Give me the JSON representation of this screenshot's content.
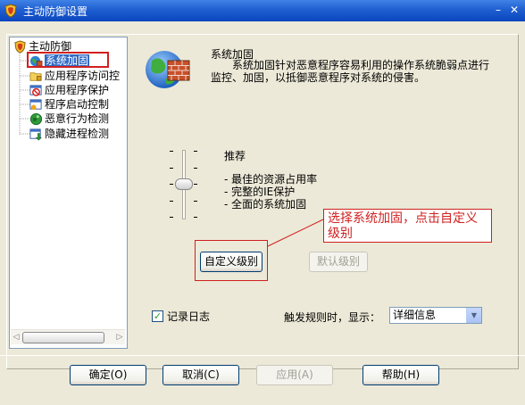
{
  "window": {
    "title": "主动防御设置",
    "minimize_label": "–",
    "close_label": "✕"
  },
  "tree": {
    "root_label": "主动防御",
    "items": [
      {
        "label": "系统加固",
        "icon": "globe-shield-icon",
        "selected": true
      },
      {
        "label": "应用程序访问控",
        "icon": "folder-lock-icon"
      },
      {
        "label": "应用程序保护",
        "icon": "forbidden-window-icon"
      },
      {
        "label": "程序启动控制",
        "icon": "window-start-icon"
      },
      {
        "label": "恶意行为检测",
        "icon": "green-globe-icon"
      },
      {
        "label": "隐藏进程检测",
        "icon": "window-down-arrow-icon"
      }
    ]
  },
  "section": {
    "title": "系统加固",
    "desc_line1": "系统加固针对恶意程序容易利用的操作系统脆弱点进行",
    "desc_line2": "监控、加固，以抵御恶意程序对系统的侵害。"
  },
  "level": {
    "title": "推荐",
    "bullets": [
      "- 最佳的资源占用率",
      "- 完整的IE保护",
      "- 全面的系统加固"
    ],
    "slider_level": "推荐"
  },
  "annotation": {
    "text": "选择系统加固，点击自定义级别"
  },
  "buttons": {
    "custom_level": "自定义级别",
    "default_level": "默认级别",
    "ok": "确定(O)",
    "cancel": "取消(C)",
    "apply": "应用(A)",
    "help": "帮助(H)"
  },
  "options": {
    "log_checked": true,
    "log_label": "记录日志",
    "show_label": "触发规则时，显示：",
    "show_value": "详细信息"
  },
  "colors": {
    "title_bar": "#1f5fd0",
    "annotation": "#d11f1f",
    "selection": "#316ac5"
  }
}
